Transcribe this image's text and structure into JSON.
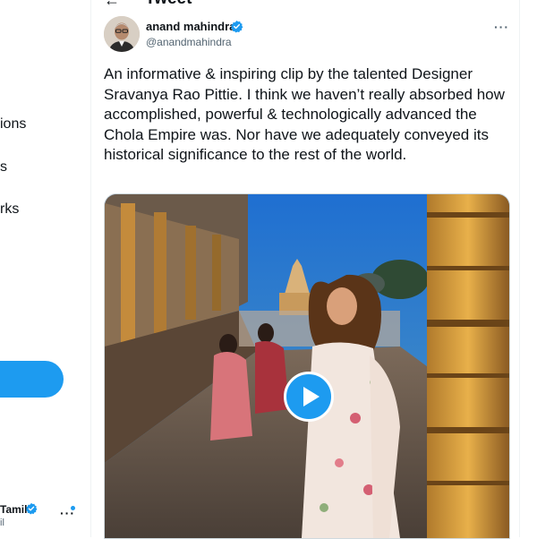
{
  "sidebar": {
    "items": [
      {
        "label": "ions"
      },
      {
        "label": "s"
      },
      {
        "label": "rks"
      }
    ],
    "account": {
      "name": "Tamil",
      "handle": "il",
      "more": "···"
    }
  },
  "header": {
    "back": "←",
    "title": "Tweet"
  },
  "tweet": {
    "author_name": "anand mahindra",
    "author_handle": "@anandmahindra",
    "more": "···",
    "text": "An informative & inspiring clip by the talented Designer Sravanya Rao Pittie. I think we haven’t really absorbed how accomplished, powerful & technologically advanced the Chola Empire was. Nor have we adequately conveyed its historical significance to the rest of the world."
  },
  "colors": {
    "accent": "#1d9bf0",
    "text": "#0f1419",
    "secondary": "#536471",
    "border": "#eff3f4"
  },
  "icons": {
    "verified": "verified-badge-icon",
    "play": "play-icon",
    "more": "more-icon"
  }
}
